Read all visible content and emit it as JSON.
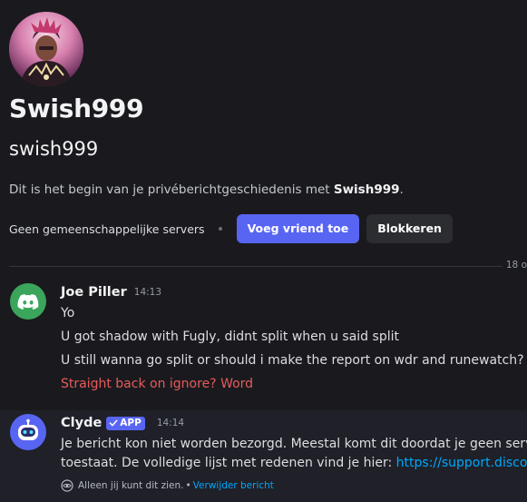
{
  "profile": {
    "display_name": "Swish999",
    "username": "swish999",
    "intro_prefix": "Dit is het begin van je privéberichtgeschiedenis met ",
    "intro_name": "Swish999",
    "intro_suffix": ".",
    "mutual_servers": "Geen gemeenschappelijke servers",
    "add_friend_label": "Voeg vriend toe",
    "block_label": "Blokkeren"
  },
  "divider": {
    "date": "18 o"
  },
  "messages": [
    {
      "author": "Joe Piller",
      "time": "14:13",
      "lines": [
        "Yo",
        "U got shadow with Fugly, didnt split when u said split",
        "U still wanna go split or should i make the report on wdr and runewatch?",
        "Straight back on ignore? Word"
      ]
    },
    {
      "author": "Clyde",
      "badge": "APP",
      "time": "14:14",
      "line1": "Je bericht kon niet worden bezorgd. Meestal komt dit doordat je geen server",
      "line2_text": "toestaat. De volledige lijst met redenen vind je hier: ",
      "line2_link": "https://support.discord.",
      "ephemeral_note": "Alleen jij kunt dit zien.",
      "separator": "•",
      "dismiss_label": "Verwijder bericht"
    }
  ],
  "colors": {
    "background": "#1a1a1e",
    "brand": "#5865f2",
    "error_text": "#e55b5b",
    "link": "#00a8fc",
    "joe_avatar": "#3ba55c"
  },
  "icons": {
    "joe_avatar": "discord-logo-icon",
    "clyde_avatar": "clyde-robot-icon",
    "badge": "checkmark-icon",
    "ephemeral": "eye-icon"
  }
}
